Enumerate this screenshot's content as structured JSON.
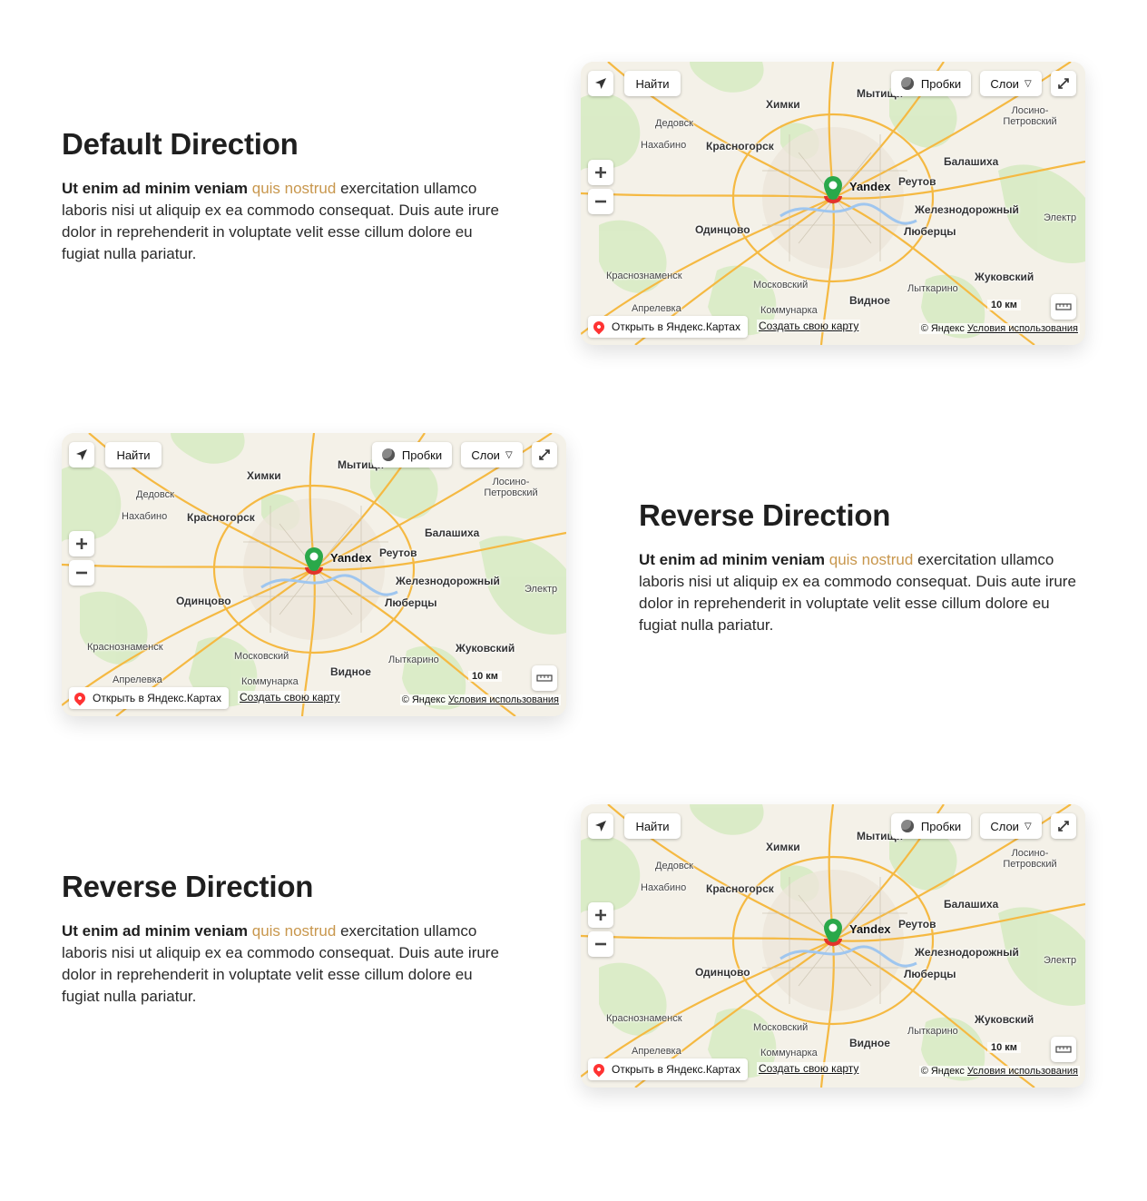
{
  "sections": [
    {
      "title": "Default Direction",
      "text_bold": "Ut enim ad minim veniam",
      "text_accent": "quis nostrud",
      "text_rest": "exercitation ullamco laboris nisi ut aliquip ex ea commodo consequat. Duis aute irure dolor in reprehenderit in voluptate velit esse cillum dolore eu fugiat nulla pariatur."
    },
    {
      "title": "Reverse Direction",
      "text_bold": "Ut enim ad minim veniam",
      "text_accent": "quis nostrud",
      "text_rest": "exercitation ullamco laboris nisi ut aliquip ex ea commodo consequat. Duis aute irure dolor in reprehenderit in voluptate velit esse cillum dolore eu fugiat nulla pariatur."
    },
    {
      "title": "Reverse Direction",
      "text_bold": "Ut enim ad minim veniam",
      "text_accent": "quis nostrud",
      "text_rest": "exercitation ullamco laboris nisi ut aliquip ex ea commodo consequat. Duis aute irure dolor in reprehenderit in voluptate velit esse cillum dolore eu fugiat nulla pariatur."
    }
  ],
  "map": {
    "find_label": "Найти",
    "traffic_label": "Пробки",
    "layers_label": "Слои",
    "open_label": "Открыть в Яндекс.Картах",
    "create_label": "Создать свою карту",
    "copyright": "© Яндекс",
    "terms": "Условия использования",
    "scale": "10 км",
    "marker_label": "Yandex",
    "cities": [
      {
        "name": "Химки"
      },
      {
        "name": "Мытищи"
      },
      {
        "name": "Дедовск"
      },
      {
        "name": "Нахабино"
      },
      {
        "name": "Красногорск"
      },
      {
        "name": "Балашиха"
      },
      {
        "name": "Реутов"
      },
      {
        "name": "Железнодорожный"
      },
      {
        "name": "Одинцово"
      },
      {
        "name": "Люберцы"
      },
      {
        "name": "Краснознаменск"
      },
      {
        "name": "Московский"
      },
      {
        "name": "Жуковский"
      },
      {
        "name": "Лыткарино"
      },
      {
        "name": "Видное"
      },
      {
        "name": "Апрелевка"
      },
      {
        "name": "Коммунарка"
      },
      {
        "name": "Лосино-Петровский"
      },
      {
        "name": "Электр"
      }
    ]
  },
  "colors": {
    "accent": "#c8974d",
    "marker_green": "#2aa84a",
    "marker_red": "#e3332b"
  }
}
